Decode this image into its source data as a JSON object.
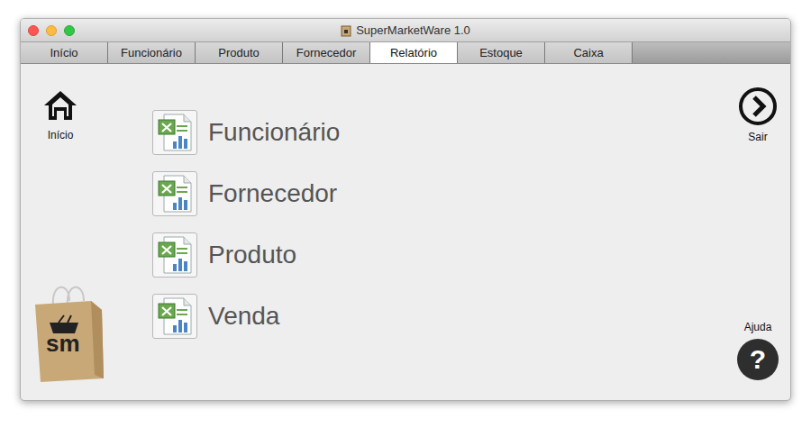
{
  "window": {
    "title": "SuperMarketWare 1.0"
  },
  "tabs": [
    {
      "label": "Início",
      "selected": false
    },
    {
      "label": "Funcionário",
      "selected": false
    },
    {
      "label": "Produto",
      "selected": false
    },
    {
      "label": "Fornecedor",
      "selected": false
    },
    {
      "label": "Relatório",
      "selected": true
    },
    {
      "label": "Estoque",
      "selected": false
    },
    {
      "label": "Caixa",
      "selected": false
    }
  ],
  "home": {
    "label": "Início"
  },
  "exit": {
    "label": "Sair"
  },
  "help": {
    "label": "Ajuda",
    "icon": "?"
  },
  "reports": [
    {
      "label": "Funcionário"
    },
    {
      "label": "Fornecedor"
    },
    {
      "label": "Produto"
    },
    {
      "label": "Venda"
    }
  ],
  "logo": {
    "text": "sm"
  }
}
